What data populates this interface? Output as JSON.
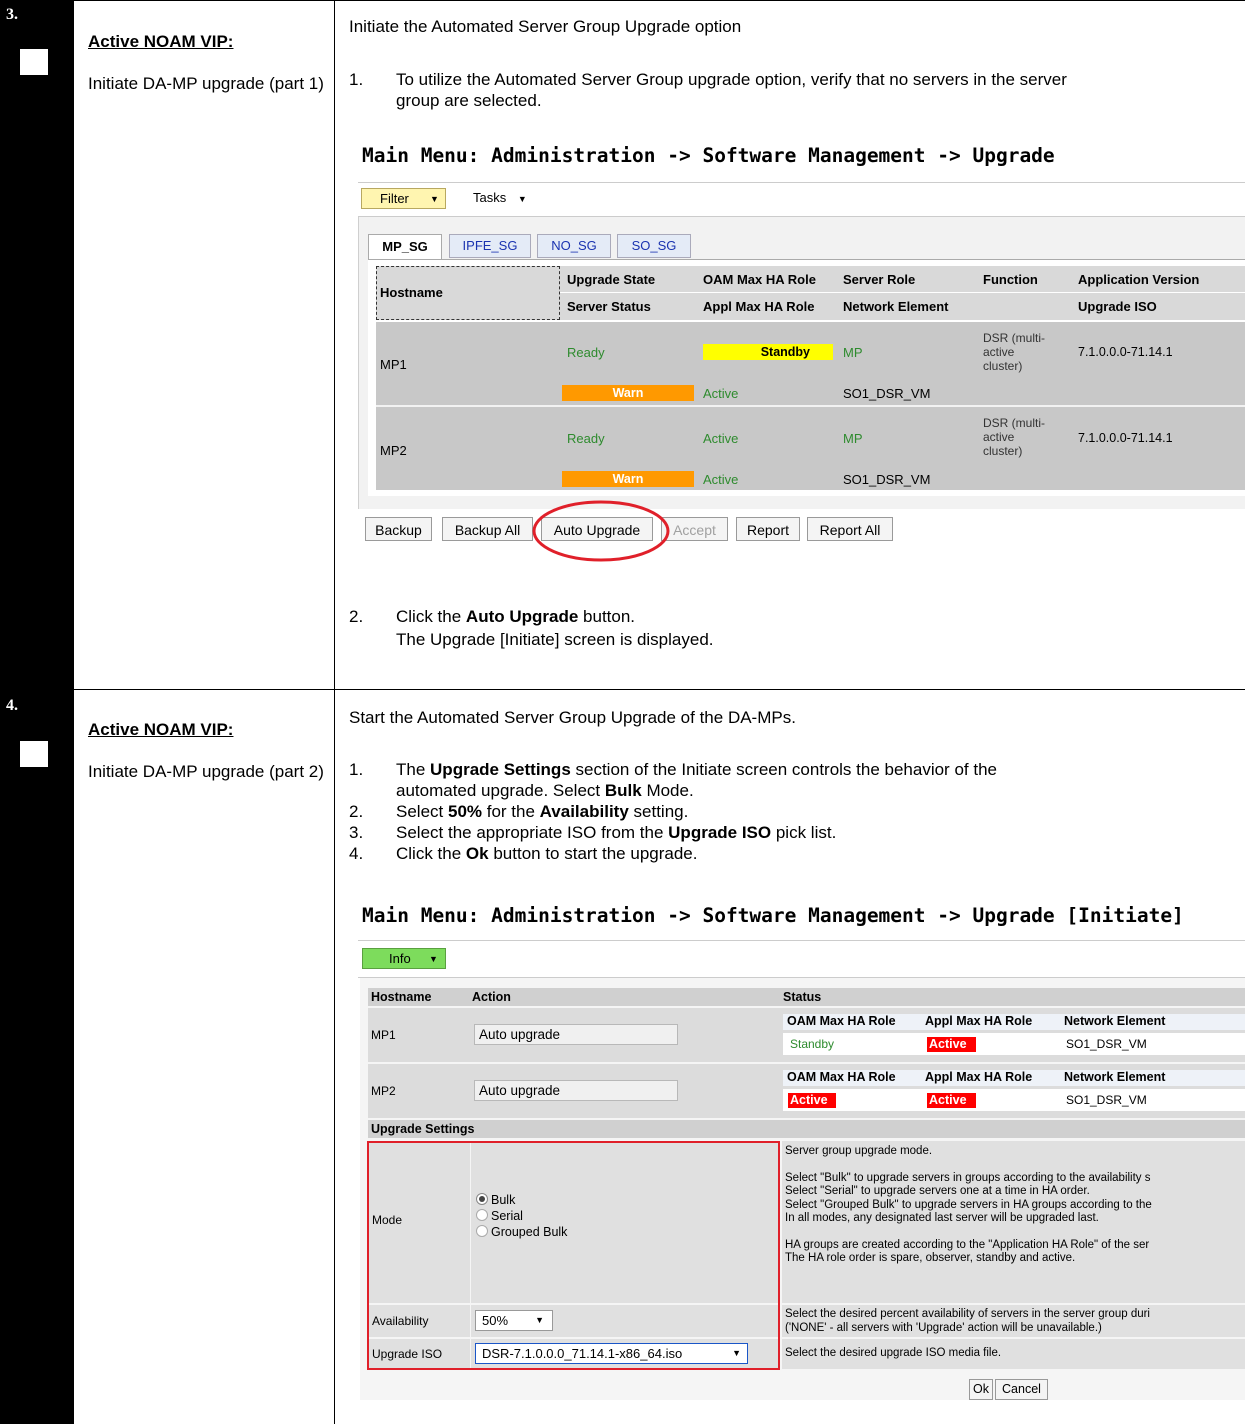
{
  "steps": [
    {
      "number": "3.",
      "role": "Active NOAM VIP:",
      "description": "Initiate DA-MP upgrade (part 1)",
      "intro": "Initiate the Automated Server Group Upgrade option",
      "item1_num": "1.",
      "item1_line1": "To utilize the Automated Server Group upgrade option, verify that no servers in the server",
      "item1_line2": "group are selected.",
      "item2_num": "2.",
      "item2_pre": "Click the ",
      "item2_bold": "Auto Upgrade",
      "item2_post": " button.",
      "item2_line2": "The Upgrade [Initiate] screen is displayed."
    },
    {
      "number": "4.",
      "role": "Active NOAM VIP:",
      "description": "Initiate DA-MP upgrade (part 2)",
      "intro": "Start the Automated Server Group Upgrade of the DA-MPs.",
      "items": [
        {
          "num": "1.",
          "l1_a": "The ",
          "l1_b": "Upgrade Settings",
          "l1_c": " section of the Initiate screen controls the behavior of the",
          "l2_a": "automated upgrade. Select ",
          "l2_b": "Bulk",
          "l2_c": " Mode."
        },
        {
          "num": "2.",
          "a": "Select ",
          "b": "50%",
          "c": " for the ",
          "d": "Availability",
          "e": " setting."
        },
        {
          "num": "3.",
          "a": "Select the appropriate ISO from the ",
          "b": "Upgrade ISO",
          "c": " pick list."
        },
        {
          "num": "4.",
          "a": "Click the ",
          "b": "Ok",
          "c": " button to start the upgrade."
        }
      ]
    }
  ],
  "upgrade_screen": {
    "title": "Main Menu: Administration -> Software Management -> Upgrade",
    "filter": "Filter",
    "tasks": "Tasks",
    "tabs": [
      "MP_SG",
      "IPFE_SG",
      "NO_SG",
      "SO_SG"
    ],
    "headers": {
      "hostname": "Hostname",
      "upgrade_state": "Upgrade State",
      "server_status": "Server Status",
      "oam_role": "OAM Max HA Role",
      "appl_role": "Appl Max HA Role",
      "server_role": "Server Role",
      "network_element": "Network Element",
      "function": "Function",
      "app_version": "Application Version",
      "upgrade_iso": "Upgrade ISO"
    },
    "rows": [
      {
        "hostname": "MP1",
        "upgrade_state": "Ready",
        "oam_role": "Standby",
        "server_role": "MP",
        "function_1": "DSR (multi-",
        "function_2": "active",
        "function_3": "cluster)",
        "app_version": "7.1.0.0.0-71.14.1",
        "server_status": "Warn",
        "appl_role": "Active",
        "network_element": "SO1_DSR_VM"
      },
      {
        "hostname": "MP2",
        "upgrade_state": "Ready",
        "oam_role": "Active",
        "server_role": "MP",
        "function_1": "DSR (multi-",
        "function_2": "active",
        "function_3": "cluster)",
        "app_version": "7.1.0.0.0-71.14.1",
        "server_status": "Warn",
        "appl_role": "Active",
        "network_element": "SO1_DSR_VM"
      }
    ],
    "buttons": [
      "Backup",
      "Backup All",
      "Auto Upgrade",
      "Accept",
      "Report",
      "Report All"
    ]
  },
  "initiate_screen": {
    "title": "Main Menu: Administration -> Software Management -> Upgrade [Initiate]",
    "info": "Info",
    "headers": {
      "hostname": "Hostname",
      "action": "Action",
      "status": "Status"
    },
    "sub_headers": {
      "oam": "OAM Max HA Role",
      "appl": "Appl Max HA Role",
      "ne": "Network Element"
    },
    "rows": [
      {
        "hostname": "MP1",
        "action": "Auto upgrade",
        "oam": "Standby",
        "appl": "Active",
        "ne": "SO1_DSR_VM"
      },
      {
        "hostname": "MP2",
        "action": "Auto upgrade",
        "oam": "Active",
        "appl": "Active",
        "ne": "SO1_DSR_VM"
      }
    ],
    "settings_header": "Upgrade Settings",
    "mode_label": "Mode",
    "mode_options": [
      "Bulk",
      "Serial",
      "Grouped Bulk"
    ],
    "mode_selected": "Bulk",
    "mode_help": [
      "Server group upgrade mode.",
      "Select \"Bulk\" to upgrade servers in groups according to the availability s",
      "Select \"Serial\" to upgrade servers one at a time in HA order.",
      "Select \"Grouped Bulk\" to upgrade servers in HA groups according to the",
      "In all modes, any designated last server will be upgraded last.",
      "HA groups are created according to the \"Application HA Role\" of the ser",
      "The HA role order is spare, observer, standby and active."
    ],
    "availability_label": "Availability",
    "availability_value": "50%",
    "availability_help": [
      "Select the desired percent availability of servers in the server group duri",
      "('NONE' - all servers with 'Upgrade' action will be unavailable.)"
    ],
    "iso_label": "Upgrade ISO",
    "iso_value": "DSR-7.1.0.0.0_71.14.1-x86_64.iso",
    "iso_help": "Select the desired upgrade ISO media file.",
    "ok": "Ok",
    "cancel": "Cancel"
  },
  "colors": {
    "warn": "#ff9900",
    "standby_yellow": "#ffff00",
    "active_red": "#ff0000",
    "green_text": "#2e8b2e",
    "highlight_red": "#e0202a",
    "filter_yellow": "#fff5b0",
    "info_green": "#7ddc5c"
  }
}
